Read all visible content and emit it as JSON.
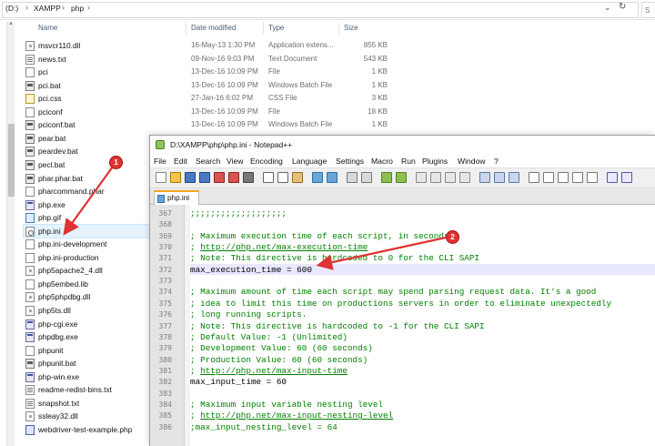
{
  "explorer": {
    "breadcrumb": [
      "(D:)",
      "XAMPP",
      "php"
    ],
    "search_stub": "S",
    "columns": {
      "name": "Name",
      "date": "Date modified",
      "type": "Type",
      "size": "Size"
    },
    "files": [
      {
        "name": "msvcr110.dll",
        "date": "16-May-13 1:30 PM",
        "type": "Application extens...",
        "size": "855 KB",
        "icon": "dll-icon"
      },
      {
        "name": "news.txt",
        "date": "09-Nov-16 9:03 PM",
        "type": "Text Document",
        "size": "543 KB",
        "icon": "txt-icon"
      },
      {
        "name": "pci",
        "date": "13-Dec-16 10:09 PM",
        "type": "File",
        "size": "1 KB",
        "icon": "file-icon"
      },
      {
        "name": "pci.bat",
        "date": "13-Dec-16 10:09 PM",
        "type": "Windows Batch File",
        "size": "1 KB",
        "icon": "bat-icon"
      },
      {
        "name": "pci.css",
        "date": "27-Jan-16 6:02 PM",
        "type": "CSS File",
        "size": "3 KB",
        "icon": "css-icon"
      },
      {
        "name": "pciconf",
        "date": "13-Dec-16 10:09 PM",
        "type": "File",
        "size": "18 KB",
        "icon": "file-icon"
      },
      {
        "name": "pciconf.bat",
        "date": "13-Dec-16 10:09 PM",
        "type": "Windows Batch File",
        "size": "1 KB",
        "icon": "bat-icon"
      },
      {
        "name": "pear.bat",
        "icon": "bat-icon"
      },
      {
        "name": "peardev.bat",
        "icon": "bat-icon"
      },
      {
        "name": "pecl.bat",
        "icon": "bat-icon"
      },
      {
        "name": "phar.phar.bat",
        "icon": "bat-icon"
      },
      {
        "name": "pharcommand.phar",
        "icon": "file-icon"
      },
      {
        "name": "php.exe",
        "icon": "exe-icon"
      },
      {
        "name": "php.gif",
        "icon": "gif-icon"
      },
      {
        "name": "php.ini",
        "icon": "ini-icon",
        "selected": true
      },
      {
        "name": "php.ini-development",
        "icon": "file-icon"
      },
      {
        "name": "php.ini-production",
        "icon": "file-icon"
      },
      {
        "name": "php5apache2_4.dll",
        "icon": "dll-icon"
      },
      {
        "name": "php5embed.lib",
        "icon": "file-icon"
      },
      {
        "name": "php5phpdbg.dll",
        "icon": "dll-icon"
      },
      {
        "name": "php5ts.dll",
        "icon": "dll-icon"
      },
      {
        "name": "php-cgi.exe",
        "icon": "exe-icon"
      },
      {
        "name": "phpdbg.exe",
        "icon": "exe-icon"
      },
      {
        "name": "phpunit",
        "icon": "file-icon"
      },
      {
        "name": "phpunit.bat",
        "icon": "bat-icon"
      },
      {
        "name": "php-win.exe",
        "icon": "exe-icon"
      },
      {
        "name": "readme-redist-bins.txt",
        "icon": "txt-icon"
      },
      {
        "name": "snapshot.txt",
        "icon": "txt-icon"
      },
      {
        "name": "ssleay32.dll",
        "icon": "dll-icon"
      },
      {
        "name": "webdriver-test-example.php",
        "icon": "php-icon"
      }
    ]
  },
  "npp": {
    "title": "D:\\XAMPP\\php\\php.ini - Notepad++",
    "menu": [
      "File",
      "Edit",
      "Search",
      "View",
      "Encoding",
      "Language",
      "Settings",
      "Macro",
      "Run",
      "Plugins",
      "Window",
      "?"
    ],
    "tab_label": "php.ini",
    "lines": [
      {
        "num": "367",
        "text": ";;;;;;;;;;;;;;;;;;;",
        "style": "comment"
      },
      {
        "num": "368",
        "text": "",
        "style": "normal"
      },
      {
        "num": "369",
        "text": "; Maximum execution time of each script, in seconds",
        "style": "comment"
      },
      {
        "num": "370",
        "text": "; http://php.net/max-execution-time",
        "style": "link"
      },
      {
        "num": "371",
        "text": "; Note: This directive is hardcoded to 0 for the CLI SAPI",
        "style": "comment"
      },
      {
        "num": "372",
        "text": "max_execution_time = 600",
        "style": "normal",
        "current": true
      },
      {
        "num": "373",
        "text": "",
        "style": "normal"
      },
      {
        "num": "374",
        "text": "; Maximum amount of time each script may spend parsing request data. It's a good",
        "style": "comment"
      },
      {
        "num": "375",
        "text": "; idea to limit this time on productions servers in order to eliminate unexpectedly",
        "style": "comment"
      },
      {
        "num": "376",
        "text": "; long running scripts.",
        "style": "comment"
      },
      {
        "num": "377",
        "text": "; Note: This directive is hardcoded to -1 for the CLI SAPI",
        "style": "comment"
      },
      {
        "num": "378",
        "text": "; Default Value: -1 (Unlimited)",
        "style": "comment"
      },
      {
        "num": "379",
        "text": "; Development Value: 60 (60 seconds)",
        "style": "comment"
      },
      {
        "num": "380",
        "text": "; Production Value: 60 (60 seconds)",
        "style": "comment"
      },
      {
        "num": "381",
        "text": "; http://php.net/max-input-time",
        "style": "link"
      },
      {
        "num": "382",
        "text": "max_input_time = 60",
        "style": "normal"
      },
      {
        "num": "383",
        "text": "",
        "style": "normal"
      },
      {
        "num": "384",
        "text": "; Maximum input variable nesting level",
        "style": "comment"
      },
      {
        "num": "385",
        "text": "; http://php.net/max-input-nesting-level",
        "style": "link"
      },
      {
        "num": "386",
        "text": ";max_input_nesting_level = 64",
        "style": "comment"
      }
    ]
  },
  "annotations": {
    "badge1": "1",
    "badge2": "2",
    "color": "#e03232"
  }
}
